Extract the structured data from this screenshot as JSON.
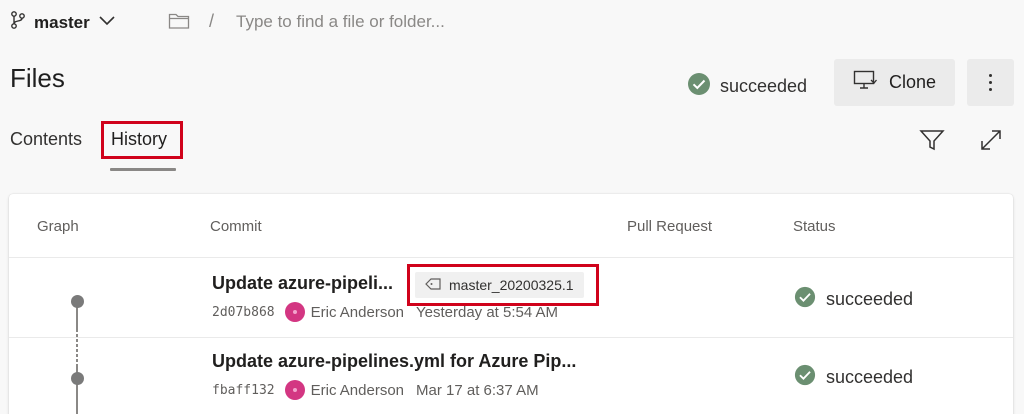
{
  "branch": {
    "name": "master"
  },
  "path": {
    "placeholder": "Type to find a file or folder...",
    "separator": "/"
  },
  "page": {
    "title": "Files"
  },
  "build": {
    "status": "succeeded"
  },
  "toolbar": {
    "clone_label": "Clone"
  },
  "tabs": [
    {
      "label": "Contents"
    },
    {
      "label": "History",
      "selected": true
    }
  ],
  "table": {
    "headers": {
      "graph": "Graph",
      "commit": "Commit",
      "pull_request": "Pull Request",
      "status": "Status"
    },
    "rows": [
      {
        "message": "Update azure-pipeli...",
        "tag": "master_20200325.1",
        "hash": "2d07b868",
        "author": "Eric Anderson",
        "date": "Yesterday at 5:54 AM",
        "status": "succeeded"
      },
      {
        "message": "Update azure-pipelines.yml for Azure Pip...",
        "hash": "fbaff132",
        "author": "Eric Anderson",
        "date": "Mar 17 at 6:37 AM",
        "status": "succeeded"
      }
    ]
  },
  "colors": {
    "success": "#6b8f71",
    "highlight": "#d0021b",
    "avatar": "#d33682"
  },
  "icons": [
    "branch-icon",
    "chevron-down-icon",
    "folder-icon",
    "check-circle-icon",
    "monitor-icon",
    "more-vertical-icon",
    "filter-icon",
    "expand-icon",
    "tag-icon"
  ]
}
